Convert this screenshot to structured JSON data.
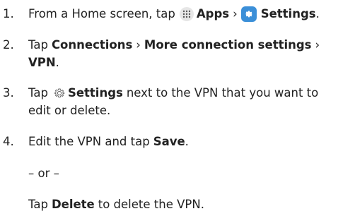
{
  "steps": [
    {
      "number": "1.",
      "text_a": "From a Home screen, tap",
      "icon_a": "apps-icon",
      "bold_a": "Apps",
      "sep": "›",
      "icon_b": "settings-app-icon",
      "bold_b": "Settings",
      "end": "."
    },
    {
      "number": "2.",
      "text_a": "Tap",
      "bold_a": "Connections",
      "sep": "›",
      "bold_b": "More connection settings",
      "sep2": "›",
      "bold_c": "VPN",
      "end": "."
    },
    {
      "number": "3.",
      "text_a": "Tap",
      "icon_a": "gear-outline-icon",
      "bold_a": "Settings",
      "text_b": "next to the VPN that you want to",
      "text_c": "edit or delete."
    },
    {
      "number": "4.",
      "text_a": "Edit the VPN and tap",
      "bold_a": "Save",
      "end": "."
    }
  ],
  "or_text": "– or –",
  "alt": {
    "text_a": "Tap",
    "bold_a": "Delete",
    "text_b": "to delete the VPN."
  },
  "colors": {
    "text": "#222222",
    "settings_icon_bg": "#3b8fd8",
    "apps_icon_bg": "#e6e6e6"
  }
}
